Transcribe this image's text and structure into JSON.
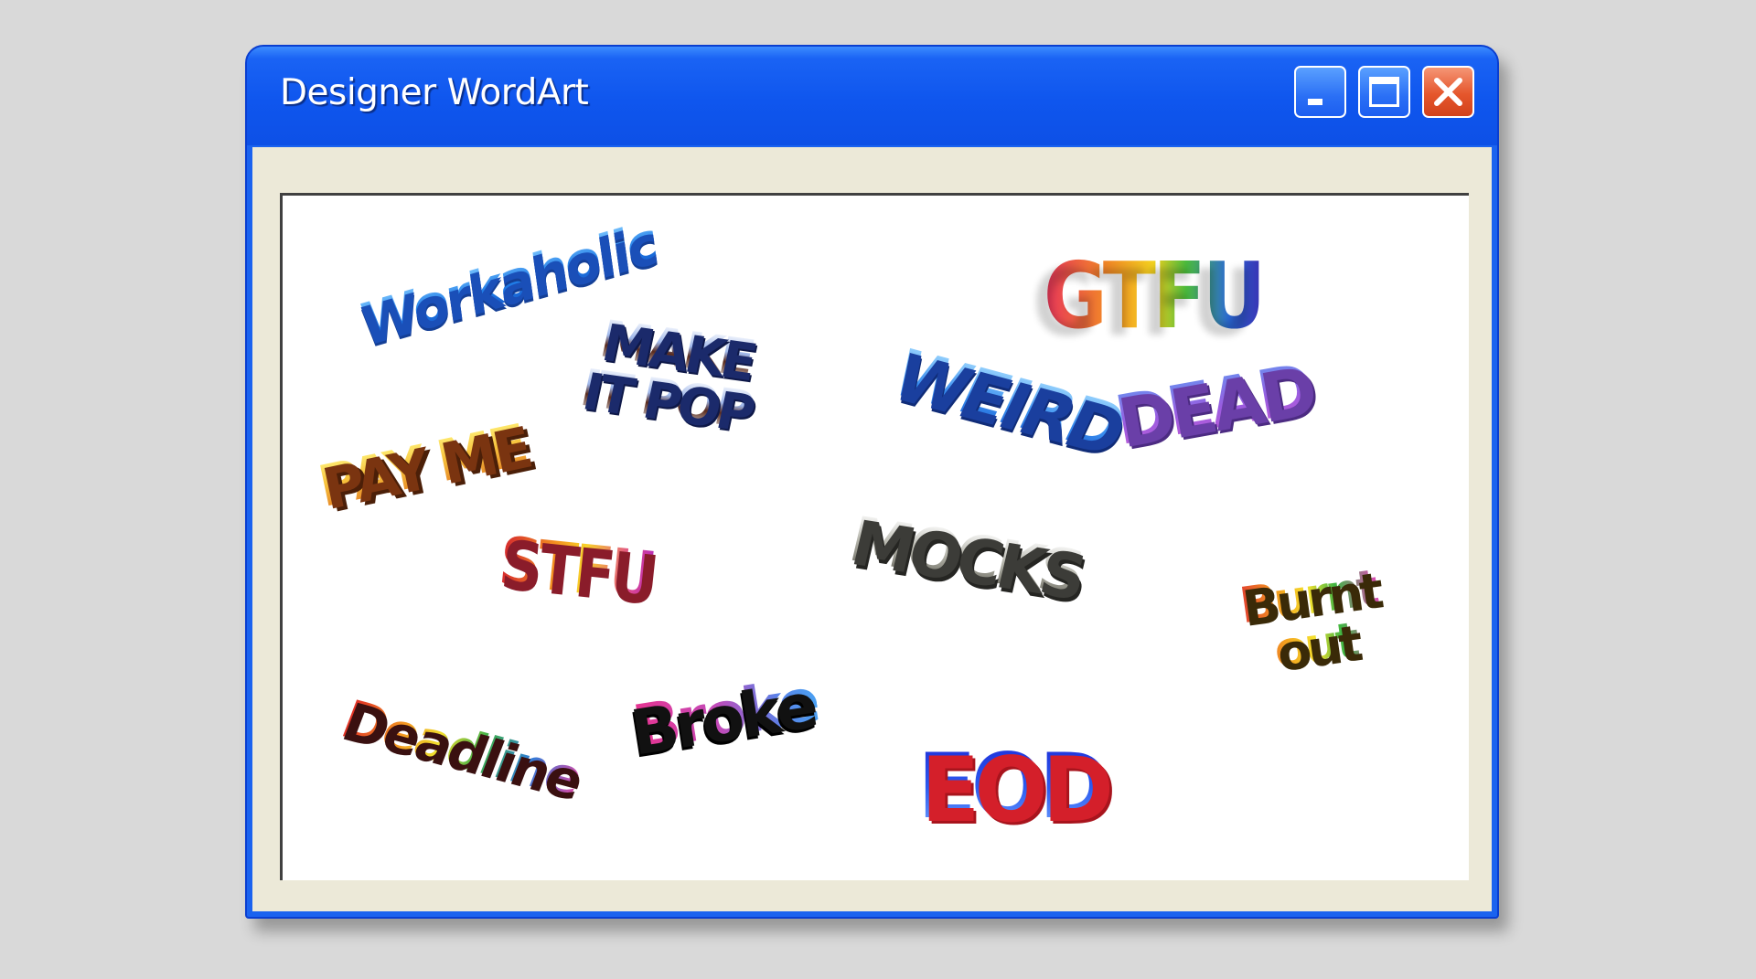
{
  "window": {
    "title": "Designer WordArt",
    "controls": [
      "minimize-icon",
      "maximize-icon",
      "close-icon"
    ]
  },
  "wordart": [
    {
      "text": "Workaholic"
    },
    {
      "line1": "MAKE",
      "line2": "IT POP"
    },
    {
      "text": "GTFU"
    },
    {
      "text": "WEIRD"
    },
    {
      "text": "DEAD"
    },
    {
      "text": "PAY ME"
    },
    {
      "text": "STFU"
    },
    {
      "text": "MOCKS"
    },
    {
      "line1": "Burnt",
      "line2": "out"
    },
    {
      "text": "Deadline"
    },
    {
      "text": "Broke"
    },
    {
      "text": "EOD"
    }
  ],
  "colors": {
    "titlebar": "#0f56ee",
    "close_button": "#e5562c",
    "client_area": "#ece9d8",
    "canvas": "#ffffff",
    "desktop": "#d9d9d9"
  }
}
